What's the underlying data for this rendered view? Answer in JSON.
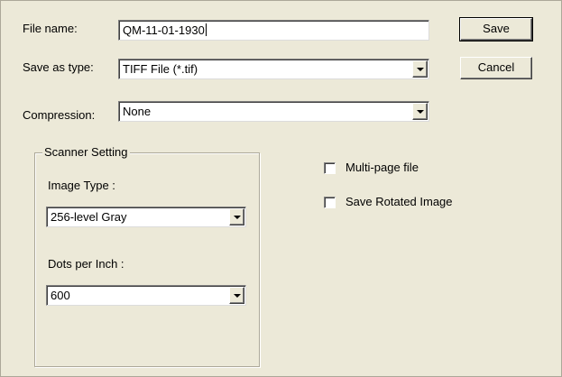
{
  "file_name": {
    "label": "File name:",
    "value": "QM-11-01-1930"
  },
  "save_as_type": {
    "label": "Save as type:",
    "value": "TIFF File (*.tif)"
  },
  "compression": {
    "label": "Compression:",
    "value": "None"
  },
  "buttons": {
    "save": "Save",
    "cancel": "Cancel"
  },
  "scanner_setting": {
    "legend": "Scanner Setting",
    "image_type": {
      "label": "Image Type :",
      "value": "256-level Gray"
    },
    "dpi": {
      "label": "Dots per Inch :",
      "value": "600"
    }
  },
  "options": {
    "multi_page": {
      "label": "Multi-page file",
      "checked": false
    },
    "save_rotated": {
      "label": "Save Rotated Image",
      "checked": false
    }
  }
}
